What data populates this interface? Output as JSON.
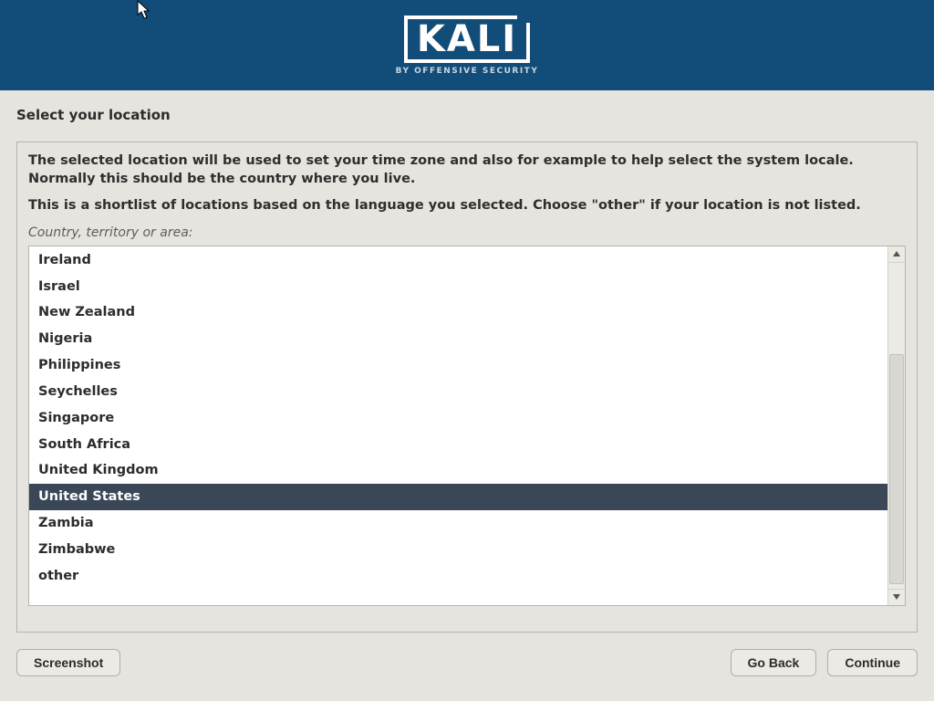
{
  "brand": {
    "name": "KALI",
    "tagline": "BY OFFENSIVE SECURITY"
  },
  "page": {
    "title": "Select your location",
    "explain1": "The selected location will be used to set your time zone and also for example to help select the system locale. Normally this should be the country where you live.",
    "explain2": "This is a shortlist of locations based on the language you selected. Choose \"other\" if your location is not listed.",
    "field_label": "Country, territory or area:"
  },
  "list": {
    "items": [
      "Ireland",
      "Israel",
      "New Zealand",
      "Nigeria",
      "Philippines",
      "Seychelles",
      "Singapore",
      "South Africa",
      "United Kingdom",
      "United States",
      "Zambia",
      "Zimbabwe",
      "other"
    ],
    "selected_index": 9
  },
  "buttons": {
    "screenshot": "Screenshot",
    "back": "Go Back",
    "continue": "Continue"
  }
}
